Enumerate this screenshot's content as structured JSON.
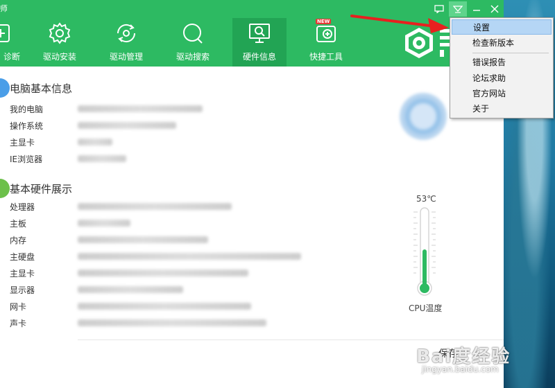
{
  "window": {
    "title_fragment": "师"
  },
  "nav": [
    {
      "label": "诊断",
      "icon": "plus-box-icon"
    },
    {
      "label": "驱动安装",
      "icon": "gear-icon"
    },
    {
      "label": "驱动管理",
      "icon": "refresh-gear-icon"
    },
    {
      "label": "驱动搜索",
      "icon": "search-icon"
    },
    {
      "label": "硬件信息",
      "icon": "monitor-search-icon",
      "active": true
    },
    {
      "label": "快捷工具",
      "icon": "toolbox-icon",
      "badge": "NEW"
    }
  ],
  "sections": {
    "pc_info": {
      "title": "电脑基本信息",
      "rows": [
        "我的电脑",
        "操作系统",
        "主显卡",
        "IE浏览器"
      ]
    },
    "hardware": {
      "title": "基本硬件展示",
      "rows": [
        "处理器",
        "主板",
        "内存",
        "主硬盘",
        "主显卡",
        "显示器",
        "网卡",
        "声卡"
      ]
    }
  },
  "cpu": {
    "temperature": "53℃",
    "temperature_value": 53,
    "label": "CPU温度"
  },
  "footer": {
    "button_label": "保存"
  },
  "dropdown_menu": {
    "items_top": [
      "设置",
      "检查新版本"
    ],
    "items_bottom": [
      "错误报告",
      "论坛求助",
      "官方网站",
      "关于"
    ],
    "highlighted": "设置"
  },
  "watermark": {
    "main": "Bai度经验",
    "sub": "jingyan.baidu.com"
  },
  "colors": {
    "brand_green": "#2dba62",
    "active_tab": "#22a454",
    "arrow_red": "#e8201f",
    "menu_highlight": "#b5d6f5"
  }
}
